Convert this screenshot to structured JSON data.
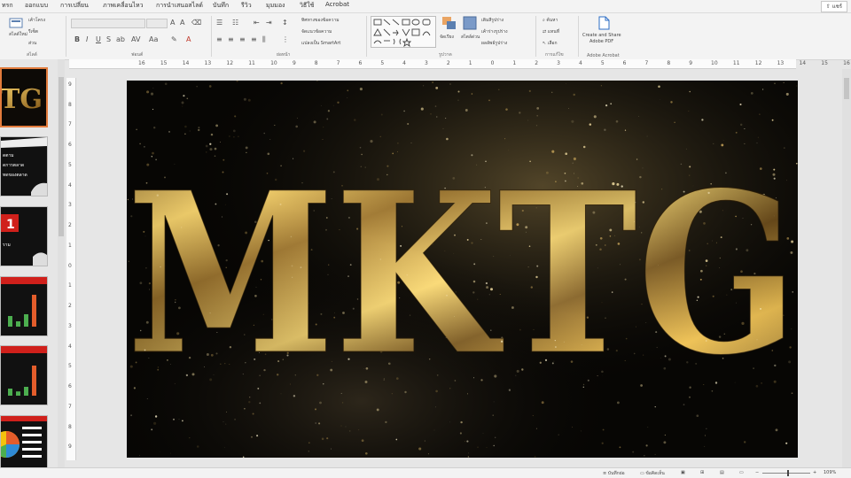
{
  "menu": [
    "ทรก",
    "ออกแบบ",
    "การเปลี่ยน",
    "ภาพเคลื่อนไหว",
    "การนำเสนอสไลด์",
    "บันทึก",
    "รีวิว",
    "มุมมอง",
    "วิธีใช้",
    "Acrobat"
  ],
  "share_label": "แชร์",
  "ribbon": {
    "new_slide": "สไลด์ใหม่",
    "layout": "เค้าโครง",
    "reset": "รีเซ็ต",
    "section": "ส่วน",
    "group_slides": "สไลด์",
    "group_font": "ฟอนต์",
    "text_direction": "ทิศทางของข้อความ",
    "align_text": "จัดแนวข้อความ",
    "convert_smartart": "แปลงเป็น SmartArt",
    "group_paragraph": "ย่อหน้า",
    "group_drawing": "รูปวาด",
    "arrange": "จัดเรียง",
    "quick_styles": "สไตล์ด่วน",
    "shape_fill": "เติมสีรูปร่าง",
    "shape_outline": "เค้าร่างรูปร่าง",
    "shape_effects": "ผลลัพธ์รูปร่าง",
    "find": "ค้นหา",
    "replace": "แทนที่",
    "select": "เลือก",
    "group_editing": "การแก้ไข",
    "adobe_create": "Create and Share",
    "adobe_pdf": "Adobe PDF",
    "group_acrobat": "Adobe Acrobat"
  },
  "ruler_h": [
    "16",
    "15",
    "14",
    "13",
    "12",
    "11",
    "10",
    "9",
    "8",
    "7",
    "6",
    "5",
    "4",
    "3",
    "2",
    "1",
    "0",
    "1",
    "2",
    "3",
    "4",
    "5",
    "6",
    "7",
    "8",
    "9",
    "10",
    "11",
    "12",
    "13",
    "14",
    "15",
    "16"
  ],
  "ruler_v": [
    "9",
    "8",
    "7",
    "6",
    "5",
    "4",
    "3",
    "2",
    "1",
    "0",
    "1",
    "2",
    "3",
    "4",
    "5",
    "6",
    "7",
    "8",
    "9"
  ],
  "slide": {
    "title": "MKTG"
  },
  "thumbnails": [
    {
      "id": "thumb-1",
      "text": "TG"
    },
    {
      "id": "thumb-2",
      "lines": [
        "ดตาม",
        "ดการตลาด",
        "ทดของตลาด"
      ]
    },
    {
      "id": "thumb-3",
      "text": "1",
      "sub": "ราม"
    },
    {
      "id": "thumb-4",
      "bars": [
        0.3,
        0.15,
        0.35,
        0.9
      ]
    },
    {
      "id": "thumb-5",
      "bars": [
        0.2,
        0.12,
        0.25,
        0.85
      ]
    },
    {
      "id": "thumb-6",
      "pie": true
    }
  ],
  "status": {
    "notes": "บันทึกย่อ",
    "comments": "ข้อคิดเห็น",
    "zoom": "109%"
  }
}
